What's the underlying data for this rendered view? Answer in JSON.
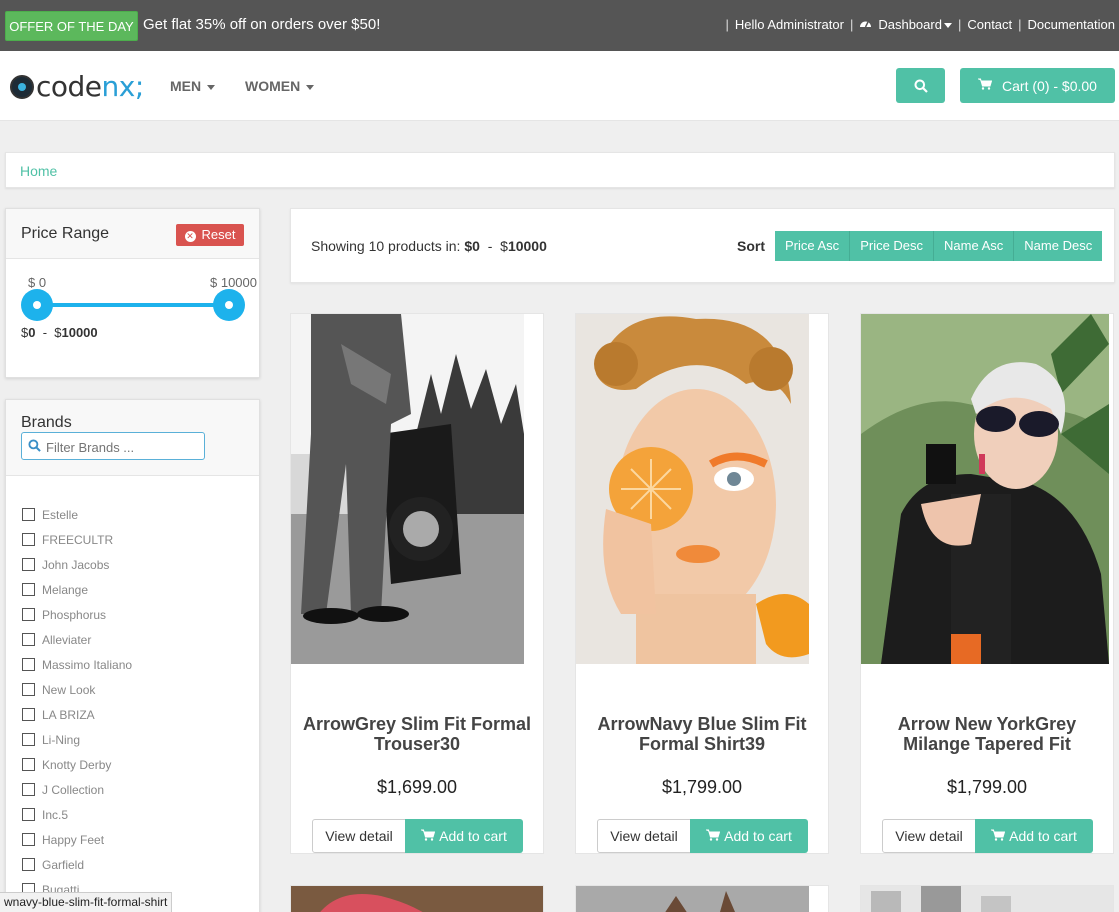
{
  "topbar": {
    "offer_badge": "OFFER OF THE DAY",
    "offer_text": "Get flat 35% off on orders over $50!",
    "hello": "Hello Administrator",
    "dashboard": "Dashboard",
    "contact": "Contact",
    "documentation": "Documentation"
  },
  "header": {
    "logo_code": "code",
    "logo_nx": "nx;",
    "nav": [
      "MEN",
      "WOMEN"
    ],
    "cart_label": "Cart (0) - $0.00"
  },
  "breadcrumb": {
    "home": "Home"
  },
  "price_range": {
    "title": "Price Range",
    "reset": "Reset",
    "min_label": "$ 0",
    "max_label": "$ 10000",
    "min_value": "0",
    "max_value": "10000",
    "min_fraction": 0,
    "max_fraction": 1
  },
  "brands": {
    "title": "Brands",
    "filter_placeholder": "Filter Brands ...",
    "items": [
      "Estelle",
      "FREECULTR",
      "John Jacobs",
      "Melange",
      "Phosphorus",
      "Alleviater",
      "Massimo Italiano",
      "New Look",
      "LA BRIZA",
      "Li-Ning",
      "Knotty Derby",
      "J Collection",
      "Inc.5",
      "Happy Feet",
      "Garfield",
      "Bugatti"
    ]
  },
  "sortbar": {
    "showing_prefix": "Showing 10 products in: ",
    "range_min": "0",
    "range_max": "10000",
    "sort_label": "Sort",
    "options": [
      "Price Asc",
      "Price Desc",
      "Name Asc",
      "Name Desc"
    ]
  },
  "products": [
    {
      "title": "ArrowGrey Slim Fit Formal Trouser30",
      "price": "$1,699.00"
    },
    {
      "title": "ArrowNavy Blue Slim Fit Formal Shirt39",
      "price": "$1,799.00"
    },
    {
      "title": "Arrow New YorkGrey Milange Tapered Fit",
      "price": "$1,799.00"
    }
  ],
  "buttons": {
    "view_detail": "View detail",
    "add_to_cart": "Add to cart"
  },
  "status_url": "wnavy-blue-slim-fit-formal-shirt",
  "colors": {
    "accent": "#50c1a6",
    "offer": "#5cb85c",
    "reset": "#d9534f",
    "slider": "#1db2ec",
    "topbar": "#555555"
  }
}
